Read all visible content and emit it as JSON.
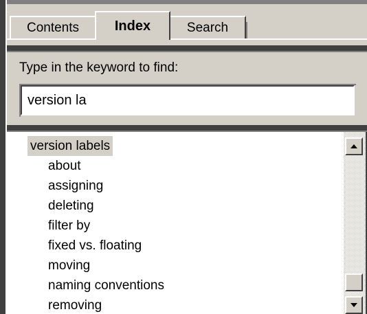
{
  "tabs": [
    {
      "label": "Contents",
      "active": false
    },
    {
      "label": "Index",
      "active": true
    },
    {
      "label": "Search",
      "active": false
    }
  ],
  "keyword": {
    "prompt": "Type in the keyword to find:",
    "value": "version la"
  },
  "index_list": {
    "items": [
      {
        "label": "version labels",
        "level": 0,
        "selected": true
      },
      {
        "label": "about",
        "level": 1,
        "selected": false
      },
      {
        "label": "assigning",
        "level": 1,
        "selected": false
      },
      {
        "label": "deleting",
        "level": 1,
        "selected": false
      },
      {
        "label": "filter by",
        "level": 1,
        "selected": false
      },
      {
        "label": "fixed vs. floating",
        "level": 1,
        "selected": false
      },
      {
        "label": "moving",
        "level": 1,
        "selected": false
      },
      {
        "label": "naming conventions",
        "level": 1,
        "selected": false
      },
      {
        "label": "removing",
        "level": 1,
        "selected": false
      }
    ]
  },
  "scrollbar": {
    "up_icon": "arrow-up-icon",
    "down_icon": "arrow-down-icon"
  },
  "colors": {
    "face": "#d4d0c8",
    "shadow": "#404040",
    "highlight": "#ffffff"
  }
}
